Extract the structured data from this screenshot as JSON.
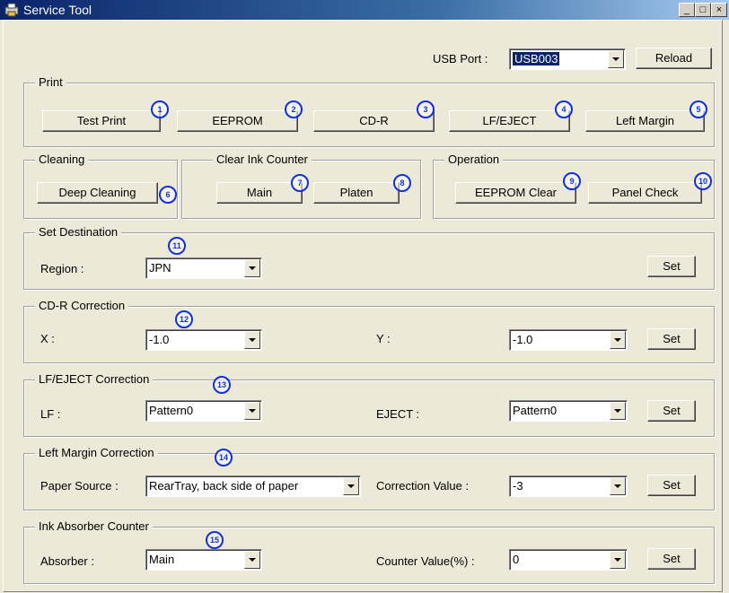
{
  "window": {
    "title": "Service Tool",
    "minimize": "_",
    "maximize": "□",
    "close": "×"
  },
  "usb": {
    "label": "USB Port :",
    "value": "USB003",
    "reload": "Reload"
  },
  "print": {
    "label": "Print",
    "buttons": [
      "Test Print",
      "EEPROM",
      "CD-R",
      "LF/EJECT",
      "Left Margin"
    ],
    "markers": [
      "1",
      "2",
      "3",
      "4",
      "5"
    ]
  },
  "cleaning": {
    "label": "Cleaning",
    "button": "Deep Cleaning",
    "marker": "6"
  },
  "ink_counter": {
    "label": "Clear Ink Counter",
    "main": "Main",
    "platen": "Platen",
    "markers": [
      "7",
      "8"
    ]
  },
  "operation": {
    "label": "Operation",
    "eeprom_clear": "EEPROM Clear",
    "panel_check": "Panel Check",
    "markers": [
      "9",
      "10"
    ]
  },
  "destination": {
    "label": "Set Destination",
    "region_label": "Region :",
    "region_value": "JPN",
    "set": "Set",
    "marker": "11"
  },
  "cdr": {
    "label": "CD-R Correction",
    "x_label": "X :",
    "x_value": "-1.0",
    "y_label": "Y :",
    "y_value": "-1.0",
    "set": "Set",
    "marker": "12"
  },
  "lf": {
    "label": "LF/EJECT Correction",
    "lf_label": "LF :",
    "lf_value": "Pattern0",
    "eject_label": "EJECT :",
    "eject_value": "Pattern0",
    "set": "Set",
    "marker": "13"
  },
  "left_margin": {
    "label": "Left Margin Correction",
    "source_label": "Paper Source :",
    "source_value": "RearTray, back side of paper",
    "corr_label": "Correction Value :",
    "corr_value": "-3",
    "set": "Set",
    "marker": "14"
  },
  "absorber": {
    "label": "Ink Absorber Counter",
    "absorber_label": "Absorber :",
    "absorber_value": "Main",
    "counter_label": "Counter Value(%) :",
    "counter_value": "0",
    "set": "Set",
    "marker": "15"
  }
}
